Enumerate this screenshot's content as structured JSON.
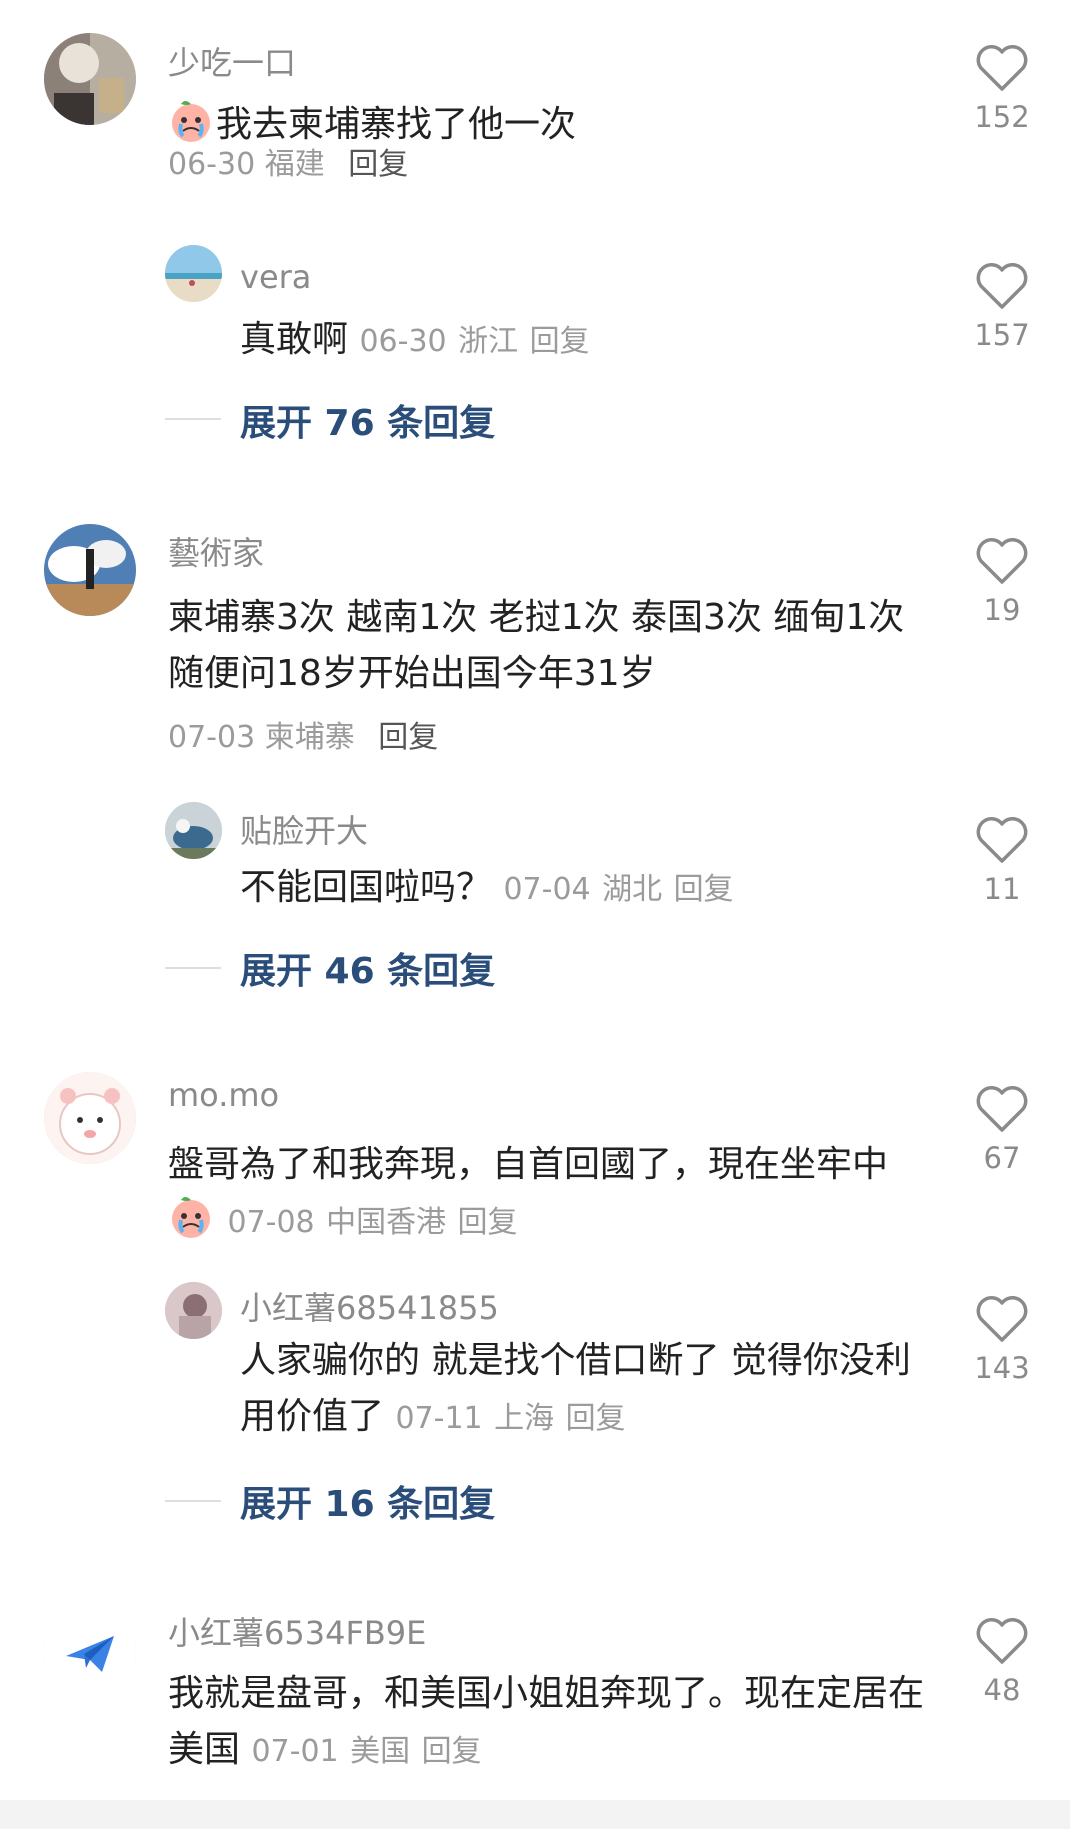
{
  "comments": [
    {
      "username": "少吃一口",
      "text": "我去柬埔寨找了他一次",
      "date": "06-30",
      "location": "福建",
      "reply_label": "回复",
      "likes": "152",
      "replies": [
        {
          "username": "vera",
          "text": "真敢啊",
          "date": "06-30",
          "location": "浙江",
          "reply_label": "回复",
          "likes": "157"
        }
      ],
      "expand_label": "展开 76 条回复"
    },
    {
      "username": "藝術家",
      "text": "柬埔寨3次 越南1次 老挝1次 泰国3次 缅甸1次 随便问18岁开始出国今年31岁",
      "date": "07-03",
      "location": "柬埔寨",
      "reply_label": "回复",
      "likes": "19",
      "replies": [
        {
          "username": "贴脸开大",
          "text": "不能回国啦吗？",
          "date": "07-04",
          "location": "湖北",
          "reply_label": "回复",
          "likes": "11"
        }
      ],
      "expand_label": "展开 46 条回复"
    },
    {
      "username": "mo.mo",
      "text": "盤哥為了和我奔現，自首回國了，現在坐牢中",
      "date": "07-08",
      "location": "中国香港",
      "reply_label": "回复",
      "likes": "67",
      "replies": [
        {
          "username": "小红薯68541855",
          "text": "人家骗你的 就是找个借口断了 觉得你没利用价值了",
          "date": "07-11",
          "location": "上海",
          "reply_label": "回复",
          "likes": "143"
        }
      ],
      "expand_label": "展开 16 条回复"
    },
    {
      "username": "小红薯6534FB9E",
      "text": "我就是盘哥，和美国小姐姐奔现了。现在定居在美国",
      "date": "07-01",
      "location": "美国",
      "reply_label": "回复",
      "likes": "48"
    }
  ],
  "icons": {
    "like": "heart-outline-icon",
    "emoji": "crying-peach-emoji-icon",
    "paper_plane": "paper-plane-icon"
  },
  "colors": {
    "username": "#8a8a8a",
    "body": "#222222",
    "meta": "#9b9b9b",
    "expand": "#2b4d7a"
  }
}
